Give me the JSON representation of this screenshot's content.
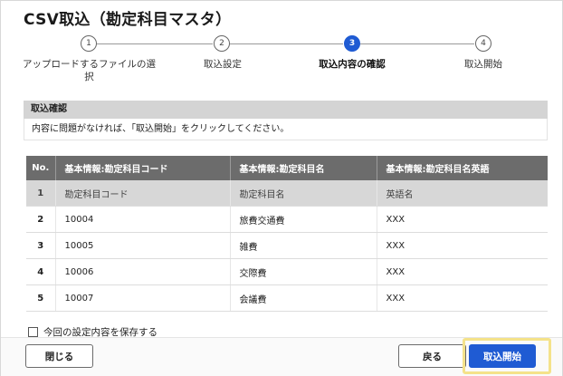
{
  "dialog": {
    "title": "CSV取込（勘定科目マスタ）"
  },
  "stepper": {
    "steps": [
      {
        "number": "1",
        "label": "アップロードするファイルの選択",
        "active": false
      },
      {
        "number": "2",
        "label": "取込設定",
        "active": false
      },
      {
        "number": "3",
        "label": "取込内容の確認",
        "active": true
      },
      {
        "number": "4",
        "label": "取込開始",
        "active": false
      }
    ]
  },
  "confirm": {
    "heading": "取込確認",
    "message": "内容に問題がなければ、「取込開始」をクリックしてください。"
  },
  "table": {
    "columns": [
      "No.",
      "基本情報:勘定科目コード",
      "基本情報:勘定科目名",
      "基本情報:勘定科目名英語"
    ],
    "rows": [
      [
        "1",
        "勘定科目コード",
        "勘定科目名",
        "英語名"
      ],
      [
        "2",
        "10004",
        "旅費交通費",
        "XXX"
      ],
      [
        "3",
        "10005",
        "雑費",
        "XXX"
      ],
      [
        "4",
        "10006",
        "交際費",
        "XXX"
      ],
      [
        "5",
        "10007",
        "会議費",
        "XXX"
      ]
    ]
  },
  "save_settings": {
    "label": "今回の設定内容を保存する",
    "checked": false
  },
  "footer": {
    "close_label": "閉じる",
    "back_label": "戻る",
    "start_label": "取込開始"
  },
  "colors": {
    "accent": "#1f5bd3",
    "highlight": "#f4e28a",
    "table_header": "#6c6c6c"
  }
}
